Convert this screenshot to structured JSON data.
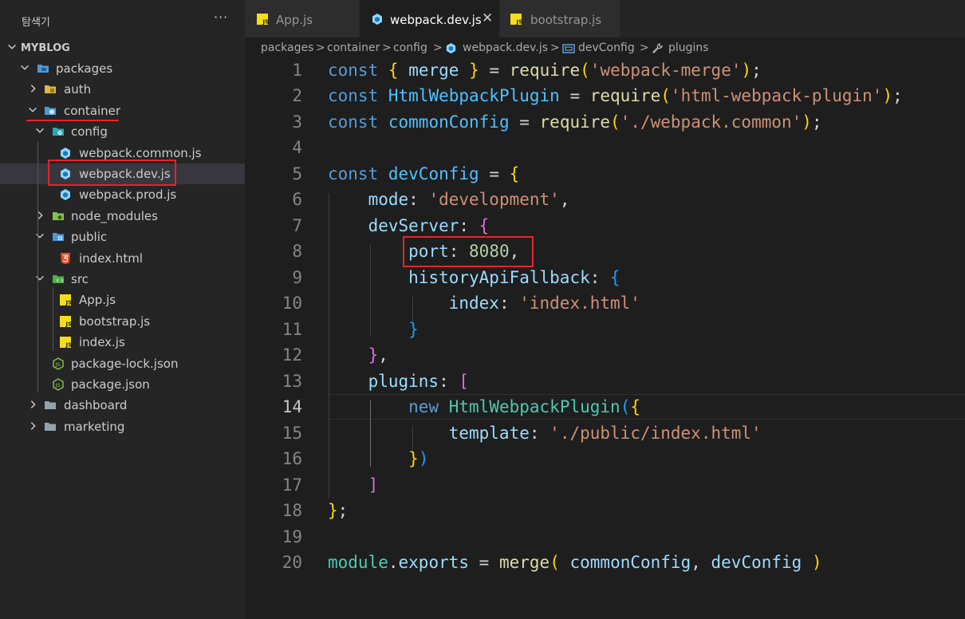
{
  "sidebar": {
    "title": "탐색기",
    "more": "···",
    "project": "MYBLOG",
    "items": [
      {
        "label": "packages"
      },
      {
        "label": "auth"
      },
      {
        "label": "container"
      },
      {
        "label": "config"
      },
      {
        "label": "webpack.common.js"
      },
      {
        "label": "webpack.dev.js"
      },
      {
        "label": "webpack.prod.js"
      },
      {
        "label": "node_modules"
      },
      {
        "label": "public"
      },
      {
        "label": "index.html"
      },
      {
        "label": "src"
      },
      {
        "label": "App.js"
      },
      {
        "label": "bootstrap.js"
      },
      {
        "label": "index.js"
      },
      {
        "label": "package-lock.json"
      },
      {
        "label": "package.json"
      },
      {
        "label": "dashboard"
      },
      {
        "label": "marketing"
      }
    ]
  },
  "tabs": [
    {
      "label": "App.js",
      "icon": "js-file-icon"
    },
    {
      "label": "webpack.dev.js",
      "icon": "webpack-file-icon",
      "active": true
    },
    {
      "label": "bootstrap.js",
      "icon": "js-file-icon"
    }
  ],
  "tab_close": "✕",
  "breadcrumb": {
    "parts": [
      "packages",
      "container",
      "config",
      "webpack.dev.js",
      "devConfig",
      "plugins"
    ],
    "separator": ">"
  },
  "editor": {
    "current_line": 14,
    "line_numbers": [
      "1",
      "2",
      "3",
      "4",
      "5",
      "6",
      "7",
      "8",
      "9",
      "10",
      "11",
      "12",
      "13",
      "14",
      "15",
      "16",
      "17",
      "18",
      "19",
      "20"
    ],
    "lines": [
      "const { merge } = require('webpack-merge');",
      "const HtmlWebpackPlugin = require('html-webpack-plugin');",
      "const commonConfig = require('./webpack.common');",
      "",
      "const devConfig = {",
      "    mode: 'development',",
      "    devServer: {",
      "        port: 8080,",
      "        historyApiFallback: {",
      "            index: 'index.html'",
      "        }",
      "    },",
      "    plugins: [",
      "        new HtmlWebpackPlugin({",
      "            template: './public/index.html'",
      "        })",
      "    ]",
      "};",
      "",
      "module.exports = merge( commonConfig, devConfig )"
    ]
  },
  "colors": {
    "annotation_red": "#e0262b",
    "editor_bg": "#1e1e1e",
    "sidebar_bg": "#252526"
  }
}
